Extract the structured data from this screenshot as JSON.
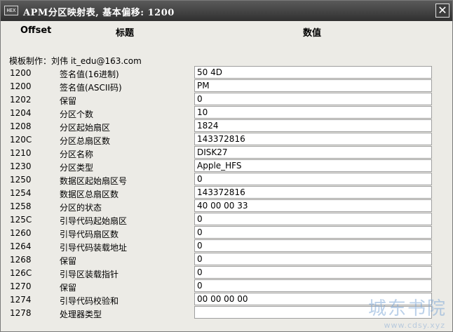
{
  "window": {
    "title": "APM分区映射表, 基本偏移: 1200",
    "icon": "HEX",
    "close_glyph": "✕"
  },
  "headers": {
    "offset": "Offset",
    "title": "标题",
    "value": "数值"
  },
  "credit": "模板制作：刘伟 it_edu@163.com",
  "rows": [
    {
      "offset": "1200",
      "label": "签名值(16进制)",
      "value": "50 4D"
    },
    {
      "offset": "1200",
      "label": "签名值(ASCII码)",
      "value": "PM"
    },
    {
      "offset": "1202",
      "label": "保留",
      "value": "0"
    },
    {
      "offset": "1204",
      "label": "分区个数",
      "value": "10"
    },
    {
      "offset": "1208",
      "label": "分区起始扇区",
      "value": "1824"
    },
    {
      "offset": "120C",
      "label": "分区总扇区数",
      "value": "143372816"
    },
    {
      "offset": "1210",
      "label": "分区名称",
      "value": "DISK27"
    },
    {
      "offset": "1230",
      "label": "分区类型",
      "value": "Apple_HFS"
    },
    {
      "offset": "1250",
      "label": "数据区起始扇区号",
      "value": "0"
    },
    {
      "offset": "1254",
      "label": "数据区总扇区数",
      "value": "143372816"
    },
    {
      "offset": "1258",
      "label": "分区的状态",
      "value": "40 00 00 33"
    },
    {
      "offset": "125C",
      "label": "引导代码起始扇区",
      "value": "0"
    },
    {
      "offset": "1260",
      "label": "引导代码扇区数",
      "value": "0"
    },
    {
      "offset": "1264",
      "label": "引导代码装载地址",
      "value": "0"
    },
    {
      "offset": "1268",
      "label": "保留",
      "value": "0"
    },
    {
      "offset": "126C",
      "label": "引导区装载指针",
      "value": "0"
    },
    {
      "offset": "1270",
      "label": "保留",
      "value": "0"
    },
    {
      "offset": "1274",
      "label": "引导代码校验和",
      "value": "00 00 00 00"
    },
    {
      "offset": "1278",
      "label": "处理器类型",
      "value": ""
    }
  ],
  "watermark": {
    "main": "城东书院",
    "sub": "www.cdsy.xyz"
  }
}
